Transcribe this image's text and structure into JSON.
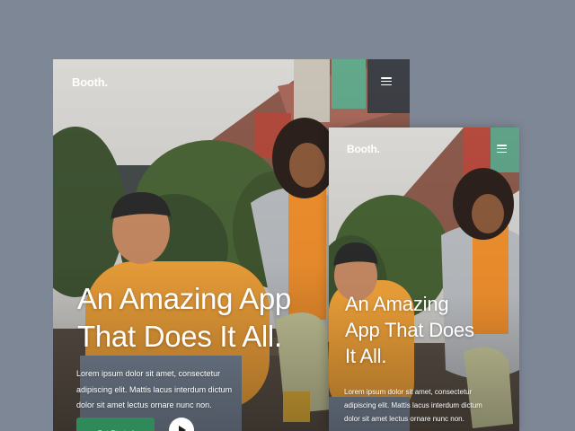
{
  "brand": {
    "name": "Booth."
  },
  "hero": {
    "headline": [
      "An Amazing App",
      "That Does It All."
    ],
    "headline_mobile": [
      "An Amazing",
      "App That Does",
      "It All."
    ],
    "body": [
      "Lorem ipsum dolor sit amet, consectetur",
      "adipiscing elit. Mattis lacus interdum dictum",
      "dolor sit amet lectus ornare nunc non."
    ],
    "cta_label": "Get Started"
  },
  "icons": {
    "menu": "hamburger-menu-icon",
    "play": "play-icon"
  },
  "colors": {
    "background": "#7e8796",
    "cta": "#2e8a58",
    "text": "#ffffff"
  }
}
